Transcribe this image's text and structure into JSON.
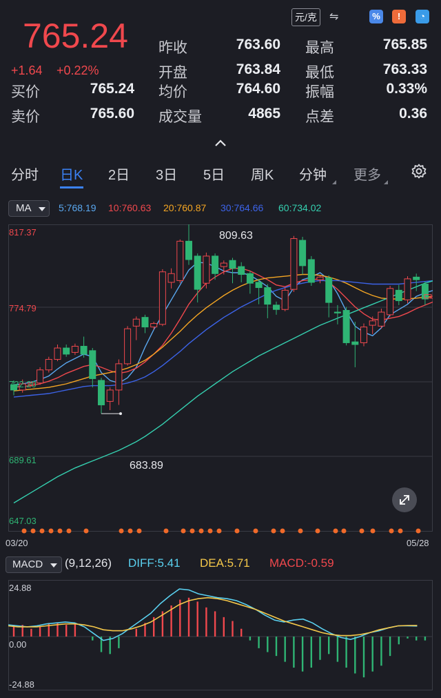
{
  "quote": {
    "price": "765.24",
    "change": "+1.64",
    "change_pct": "+0.22%",
    "unit": "元/克",
    "rows": [
      {
        "l1": "昨收",
        "v1": "763.60",
        "l2": "最高",
        "v2": "765.85"
      },
      {
        "l1": "开盘",
        "v1": "763.84",
        "l2": "最低",
        "v2": "763.33"
      },
      {
        "l1": "均价",
        "v1": "764.60",
        "l2": "振幅",
        "v2": "0.33%"
      },
      {
        "l1": "成交量",
        "v1": "4865",
        "l2": "点差",
        "v2": "0.36"
      }
    ],
    "bid_label": "买价",
    "bid": "765.24",
    "ask_label": "卖价",
    "ask": "765.60"
  },
  "tabs": [
    "分时",
    "日K",
    "2日",
    "3日",
    "5日",
    "周K",
    "分钟",
    "更多"
  ],
  "active_tab": 1,
  "ma": {
    "label": "MA",
    "items": [
      {
        "text": "5:768.19",
        "color": "#5aa8f0"
      },
      {
        "text": "10:760.63",
        "color": "#f0484d"
      },
      {
        "text": "20:760.87",
        "color": "#f5a623"
      },
      {
        "text": "30:764.66",
        "color": "#3c63e8"
      },
      {
        "text": "60:734.02",
        "color": "#35d0b0"
      }
    ]
  },
  "kline": {
    "y_labels": [
      "817.37",
      "774.79",
      "732.20",
      "689.61",
      "647.03"
    ],
    "high_label": "809.63",
    "low_label": "683.89",
    "start_date": "03/20",
    "end_date": "05/28"
  },
  "macd": {
    "label": "MACD",
    "params": "(9,12,26)",
    "diff": "DIFF:5.41",
    "dea": "DEA:5.71",
    "macd": "MACD:-0.59",
    "y_labels": [
      "24.88",
      "0.00",
      "-24.88"
    ]
  },
  "chart_data": [
    {
      "type": "candlestick",
      "title": "",
      "x_range": [
        "03/20",
        "05/28"
      ],
      "ylim": [
        647.03,
        817.37
      ],
      "candles": [
        {
          "o": 730.5,
          "c": 727.5,
          "h": 733.0,
          "l": 724.5
        },
        {
          "o": 727.5,
          "c": 731.0,
          "h": 733.5,
          "l": 726.0
        },
        {
          "o": 730.5,
          "c": 731.5,
          "h": 732.5,
          "l": 729.5
        },
        {
          "o": 731.5,
          "c": 739.0,
          "h": 740.5,
          "l": 730.5
        },
        {
          "o": 739.0,
          "c": 745.0,
          "h": 746.5,
          "l": 737.5
        },
        {
          "o": 745.0,
          "c": 751.5,
          "h": 753.5,
          "l": 744.0
        },
        {
          "o": 751.5,
          "c": 748.0,
          "h": 753.5,
          "l": 746.5
        },
        {
          "o": 749.0,
          "c": 752.5,
          "h": 754.0,
          "l": 747.5
        },
        {
          "o": 752.5,
          "c": 748.0,
          "h": 758.0,
          "l": 746.0
        },
        {
          "o": 750.0,
          "c": 734.0,
          "h": 751.5,
          "l": 729.0
        },
        {
          "o": 733.0,
          "c": 719.0,
          "h": 734.5,
          "l": 714.0
        },
        {
          "o": 721.0,
          "c": 727.5,
          "h": 729.0,
          "l": 716.0
        },
        {
          "o": 727.5,
          "c": 742.5,
          "h": 745.0,
          "l": 719.0
        },
        {
          "o": 742.5,
          "c": 762.5,
          "h": 764.0,
          "l": 741.5
        },
        {
          "o": 764.0,
          "c": 768.0,
          "h": 769.5,
          "l": 756.0
        },
        {
          "o": 769.0,
          "c": 763.5,
          "h": 770.5,
          "l": 760.0
        },
        {
          "o": 763.5,
          "c": 765.5,
          "h": 766.5,
          "l": 762.0
        },
        {
          "o": 765.0,
          "c": 795.0,
          "h": 796.5,
          "l": 764.0
        },
        {
          "o": 789.0,
          "c": 794.0,
          "h": 797.0,
          "l": 785.5
        },
        {
          "o": 790.0,
          "c": 812.5,
          "h": 813.5,
          "l": 788.5
        },
        {
          "o": 812.5,
          "c": 802.0,
          "h": 825.0,
          "l": 799.0
        },
        {
          "o": 804.0,
          "c": 785.0,
          "h": 805.5,
          "l": 777.5
        },
        {
          "o": 788.5,
          "c": 804.0,
          "h": 806.0,
          "l": 785.5
        },
        {
          "o": 804.0,
          "c": 794.0,
          "h": 805.5,
          "l": 790.5
        },
        {
          "o": 798.0,
          "c": 800.0,
          "h": 801.5,
          "l": 793.5
        },
        {
          "o": 801.5,
          "c": 797.0,
          "h": 803.0,
          "l": 788.5
        },
        {
          "o": 798.0,
          "c": 793.5,
          "h": 800.5,
          "l": 789.0
        },
        {
          "o": 794.0,
          "c": 788.5,
          "h": 795.5,
          "l": 782.5
        },
        {
          "o": 789.0,
          "c": 786.0,
          "h": 791.0,
          "l": 776.5
        },
        {
          "o": 786.0,
          "c": 776.5,
          "h": 788.0,
          "l": 768.5
        },
        {
          "o": 776.0,
          "c": 773.5,
          "h": 778.0,
          "l": 770.5
        },
        {
          "o": 773.5,
          "c": 784.5,
          "h": 786.0,
          "l": 772.5
        },
        {
          "o": 785.0,
          "c": 814.0,
          "h": 815.5,
          "l": 783.5
        },
        {
          "o": 813.0,
          "c": 798.5,
          "h": 815.0,
          "l": 793.5
        },
        {
          "o": 802.0,
          "c": 789.0,
          "h": 804.0,
          "l": 787.0
        },
        {
          "o": 790.5,
          "c": 792.0,
          "h": 793.0,
          "l": 788.5
        },
        {
          "o": 791.5,
          "c": 777.5,
          "h": 793.0,
          "l": 769.0
        },
        {
          "o": 772.0,
          "c": 771.5,
          "h": 776.0,
          "l": 765.0
        },
        {
          "o": 773.0,
          "c": 754.5,
          "h": 775.0,
          "l": 753.0
        },
        {
          "o": 755.0,
          "c": 753.5,
          "h": 766.5,
          "l": 740.5
        },
        {
          "o": 754.5,
          "c": 763.5,
          "h": 765.5,
          "l": 752.5
        },
        {
          "o": 764.5,
          "c": 767.0,
          "h": 769.5,
          "l": 759.5
        },
        {
          "o": 764.0,
          "c": 772.0,
          "h": 774.0,
          "l": 762.5
        },
        {
          "o": 770.5,
          "c": 785.5,
          "h": 787.0,
          "l": 769.5
        },
        {
          "o": 784.5,
          "c": 778.5,
          "h": 787.5,
          "l": 776.0
        },
        {
          "o": 779.0,
          "c": 791.0,
          "h": 792.5,
          "l": 777.0
        },
        {
          "o": 792.0,
          "c": 790.5,
          "h": 794.0,
          "l": 784.0
        },
        {
          "o": 788.0,
          "c": 779.5,
          "h": 789.5,
          "l": 776.0
        },
        {
          "o": 780.0,
          "c": 781.0,
          "h": 782.0,
          "l": 778.5
        }
      ],
      "series": [
        {
          "name": "5",
          "values": [
            730.5,
            731.0,
            732.0,
            733.5,
            735.5,
            739.5,
            743.0,
            745.5,
            748.0,
            746.5,
            737.5,
            733.0,
            731.5,
            734.5,
            740.5,
            752.0,
            762.0,
            770.5,
            779.0,
            787.5,
            796.0,
            800.5,
            800.0,
            798.0,
            795.5,
            794.5,
            794.5,
            793.0,
            790.0,
            786.5,
            781.0,
            778.5,
            786.0,
            790.5,
            792.0,
            794.5,
            790.5,
            782.5,
            772.5,
            764.0,
            760.5,
            758.5,
            763.0,
            770.5,
            773.5,
            776.5,
            781.0,
            783.0,
            784.5
          ]
        },
        {
          "name": "10",
          "values": [
            729.0,
            729.5,
            730.0,
            731.0,
            732.5,
            734.5,
            737.0,
            739.0,
            741.0,
            742.0,
            740.5,
            738.5,
            737.0,
            738.0,
            740.0,
            743.5,
            748.0,
            753.0,
            760.0,
            768.0,
            776.5,
            783.0,
            788.5,
            792.0,
            795.0,
            797.0,
            797.0,
            795.5,
            793.0,
            790.5,
            787.5,
            786.5,
            788.5,
            790.0,
            790.5,
            791.0,
            789.0,
            785.0,
            780.0,
            775.0,
            771.0,
            768.0,
            767.5,
            768.5,
            769.5,
            771.5,
            774.0,
            776.0,
            778.0
          ]
        },
        {
          "name": "20",
          "values": [
            727.0,
            727.5,
            728.0,
            728.5,
            729.0,
            730.0,
            731.0,
            732.5,
            734.0,
            735.5,
            736.5,
            737.5,
            738.5,
            740.0,
            742.0,
            744.5,
            748.0,
            752.0,
            756.5,
            761.0,
            766.0,
            770.5,
            774.5,
            778.0,
            781.5,
            784.5,
            787.0,
            789.0,
            790.5,
            791.5,
            792.0,
            792.5,
            793.0,
            793.5,
            793.5,
            793.0,
            792.0,
            790.5,
            788.5,
            786.0,
            783.5,
            781.5,
            780.0,
            779.5,
            779.5,
            779.5,
            780.0,
            780.5,
            781.0
          ]
        },
        {
          "name": "30",
          "values": [
            723.5,
            724.0,
            724.5,
            725.0,
            725.5,
            726.5,
            727.5,
            728.5,
            729.5,
            730.0,
            730.0,
            730.0,
            730.5,
            731.5,
            733.0,
            735.0,
            738.0,
            741.5,
            745.5,
            749.5,
            754.0,
            758.0,
            762.0,
            765.5,
            769.0,
            772.0,
            775.0,
            777.5,
            780.0,
            782.5,
            784.5,
            786.0,
            787.5,
            788.5,
            789.5,
            790.0,
            790.0,
            790.0,
            789.5,
            789.0,
            788.5,
            788.0,
            788.0,
            788.0,
            788.0,
            788.5,
            789.0,
            789.5,
            790.0
          ]
        },
        {
          "name": "60",
          "values": [
            663.0,
            666.0,
            669.0,
            672.0,
            675.0,
            678.0,
            680.5,
            683.0,
            685.0,
            687.0,
            689.0,
            691.0,
            693.0,
            695.5,
            698.0,
            701.0,
            704.5,
            708.0,
            712.0,
            716.0,
            720.0,
            724.0,
            727.5,
            731.0,
            734.5,
            738.0,
            741.0,
            744.0,
            747.0,
            749.5,
            752.0,
            754.5,
            757.0,
            759.5,
            762.0,
            764.5,
            766.5,
            768.5,
            770.5,
            772.5,
            774.5,
            776.5,
            778.5,
            780.5,
            782.5,
            784.5,
            786.5,
            788.5,
            790.0
          ]
        }
      ],
      "annotations": [
        {
          "text": "809.63",
          "kind": "high"
        },
        {
          "text": "683.89",
          "kind": "low"
        }
      ],
      "y_ticks": [
        817.37,
        774.79,
        732.2,
        689.61,
        647.03
      ],
      "x_ticks": [
        "03/20",
        "05/28"
      ]
    },
    {
      "type": "macd",
      "title": "",
      "ylim": [
        -24.88,
        24.88
      ],
      "y_ticks": [
        24.88,
        0.0,
        -24.88
      ],
      "histogram": [
        6,
        6,
        4,
        5,
        7,
        7,
        6,
        7,
        0,
        -2,
        -8,
        -9,
        -6,
        0,
        4,
        7,
        10,
        13,
        16,
        19,
        20,
        18,
        15,
        13,
        10,
        8,
        4,
        -2,
        -6,
        -8,
        -10,
        -13,
        -16,
        -18,
        -16,
        -12,
        -9,
        -13,
        -16,
        -19,
        -21,
        -18,
        -15,
        -10,
        -4,
        -1,
        -2,
        -2
      ],
      "series": [
        {
          "name": "DIFF",
          "values": [
            6.0,
            5.5,
            5.0,
            5.5,
            6.5,
            7.0,
            7.5,
            7.0,
            5.0,
            1.5,
            -2.0,
            -1.0,
            1.5,
            5.0,
            8.5,
            12.0,
            17.0,
            21.0,
            24.5,
            24.0,
            22.0,
            21.0,
            20.0,
            19.5,
            18.5,
            16.5,
            14.0,
            11.0,
            8.5,
            7.5,
            8.5,
            9.0,
            7.0,
            4.0,
            1.5,
            -0.5,
            -1.5,
            0.0,
            2.0,
            3.0,
            4.5,
            5.5,
            5.5,
            5.4
          ]
        },
        {
          "name": "DEA",
          "values": [
            5.5,
            5.0,
            5.0,
            5.0,
            5.5,
            6.0,
            6.5,
            6.5,
            6.0,
            5.0,
            3.5,
            3.0,
            3.0,
            4.0,
            5.5,
            7.5,
            10.5,
            13.5,
            16.5,
            18.5,
            19.5,
            20.0,
            19.5,
            18.5,
            17.0,
            15.5,
            14.0,
            12.0,
            10.0,
            8.0,
            6.5,
            5.0,
            3.5,
            2.0,
            1.0,
            0.5,
            0.5,
            1.0,
            2.0,
            3.5,
            4.5,
            5.5,
            5.7,
            5.71
          ]
        }
      ]
    }
  ]
}
